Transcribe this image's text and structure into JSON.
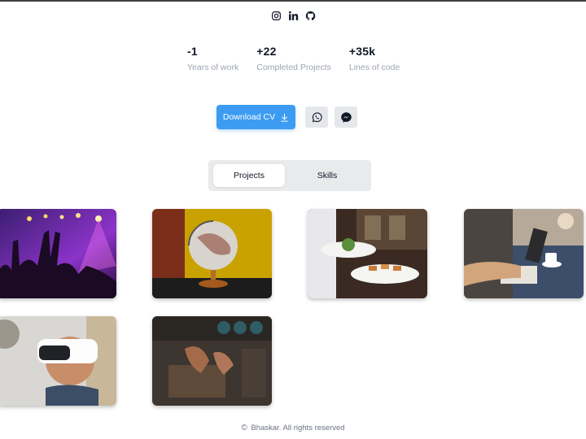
{
  "socials": [
    {
      "icon": "instagram-icon"
    },
    {
      "icon": "linkedin-icon"
    },
    {
      "icon": "github-icon"
    }
  ],
  "stats": [
    {
      "value": "-1",
      "label": "Years of work"
    },
    {
      "value": "+22",
      "label": "Completed Projects"
    },
    {
      "value": "+35k",
      "label": "Lines of code"
    }
  ],
  "cta": {
    "download_label": "Download CV",
    "download_icon": "download-arrow-icon",
    "whatsapp_icon": "whatsapp-icon",
    "messenger_icon": "messenger-icon"
  },
  "tabs": {
    "projects": "Projects",
    "skills": "Skills",
    "active": "Projects"
  },
  "projects": [
    {
      "image": "concert-crowd"
    },
    {
      "image": "globe-on-yellow"
    },
    {
      "image": "restaurant-plates"
    },
    {
      "image": "laptop-coffee"
    },
    {
      "image": "vr-headset-child"
    },
    {
      "image": "hands-tools-workbench"
    }
  ],
  "footer": {
    "copyright_symbol": "©",
    "text": "Bhaskar. All rights reserved"
  },
  "colors": {
    "accent": "#3b9cf1",
    "tab_bg": "#e9eaec",
    "muted_text": "#9ca3af"
  }
}
